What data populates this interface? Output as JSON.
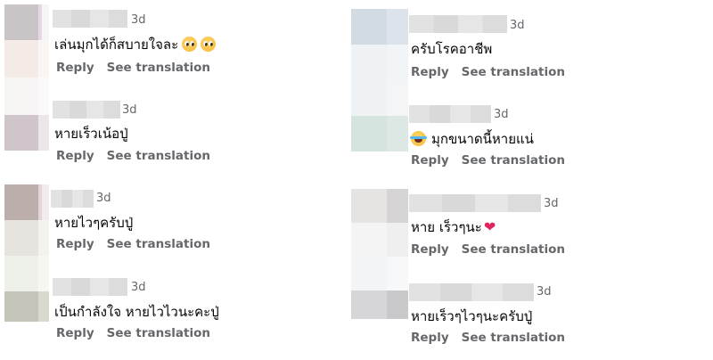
{
  "colors": {
    "meta_text": "#65676b",
    "body_text": "#050505",
    "heart": "#e0245e"
  },
  "left_column": [
    {
      "time": "3d",
      "text": "เล่นมุกได้ก็สบายใจละ",
      "emojis": [
        "pleading-face-emoji",
        "pleading-face-emoji"
      ],
      "reply": "Reply",
      "translate": "See translation"
    },
    {
      "time": "3d",
      "text": "หายเร็วเน้อปู่",
      "reply": "Reply",
      "translate": "See translation"
    },
    {
      "time": "3d",
      "text": "หายไวๆครับปู่",
      "reply": "Reply",
      "translate": "See translation"
    },
    {
      "time": "3d",
      "text": "เป็นกำลังใจ หายไวไวนะคะปู่",
      "reply": "Reply",
      "translate": "See translation"
    }
  ],
  "right_column": [
    {
      "time": "3d",
      "text": "ครับโรคอาชีพ",
      "reply": "Reply",
      "translate": "See translation"
    },
    {
      "time": "3d",
      "text": "มุกขนาดนี้หายแน่",
      "emoji_prefix": "face-with-tears-of-joy-emoji",
      "reply": "Reply",
      "translate": "See translation"
    },
    {
      "time": "3d",
      "text": "หาย เร็วๆนะ",
      "emoji_suffix": "red-heart-emoji",
      "heart_glyph": "❤",
      "reply": "Reply",
      "translate": "See translation"
    },
    {
      "time": "3d",
      "text": "หายเร็วๆไวๆนะครับปู่",
      "reply": "Reply",
      "translate": "See translation"
    }
  ]
}
